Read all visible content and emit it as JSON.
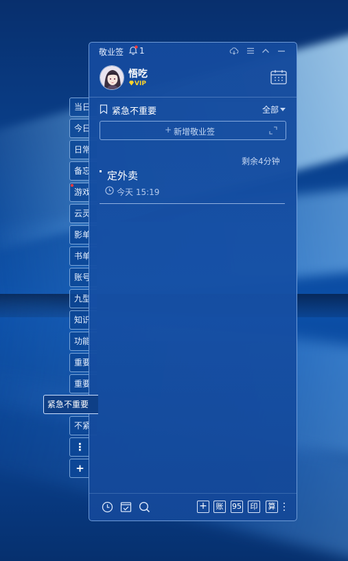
{
  "app": {
    "title": "敬业签",
    "notification_count": "1",
    "user": {
      "name": "悟吃",
      "badge": "VIP"
    }
  },
  "side_tabs": [
    {
      "label": "当日",
      "active": false,
      "dot": false
    },
    {
      "label": "今日",
      "active": false,
      "dot": false
    },
    {
      "label": "日常",
      "active": false,
      "dot": false
    },
    {
      "label": "备忘",
      "active": false,
      "dot": false
    },
    {
      "label": "游戏",
      "active": false,
      "dot": true
    },
    {
      "label": "云灵",
      "active": false,
      "dot": false
    },
    {
      "label": "影单",
      "active": false,
      "dot": false
    },
    {
      "label": "书单",
      "active": false,
      "dot": false
    },
    {
      "label": "账号",
      "active": false,
      "dot": false
    },
    {
      "label": "九型",
      "active": false,
      "dot": false
    },
    {
      "label": "知识",
      "active": false,
      "dot": false
    },
    {
      "label": "功能",
      "active": false,
      "dot": false
    },
    {
      "label": "重要",
      "active": false,
      "dot": false
    },
    {
      "label": "重要",
      "active": false,
      "dot": false
    },
    {
      "label": "紧急不重要",
      "active": true,
      "dot": false
    },
    {
      "label": "不紧",
      "active": false,
      "dot": false
    }
  ],
  "side_buttons": {
    "more": "⋮",
    "add": "+"
  },
  "category": {
    "title": "紧急不重要",
    "filter": "全部"
  },
  "add_note": {
    "plus": "+",
    "label": "新增敬业签"
  },
  "note": {
    "remaining": "剩余4分钟",
    "title": "定外卖",
    "time": "今天 15:19"
  },
  "footer": {
    "buttons": [
      "+",
      "账",
      "95",
      "印",
      "算"
    ]
  },
  "colors": {
    "panel_bg": "#164a9c",
    "accent_red": "#ff3b3b",
    "vip_gold": "#ffd42a"
  }
}
